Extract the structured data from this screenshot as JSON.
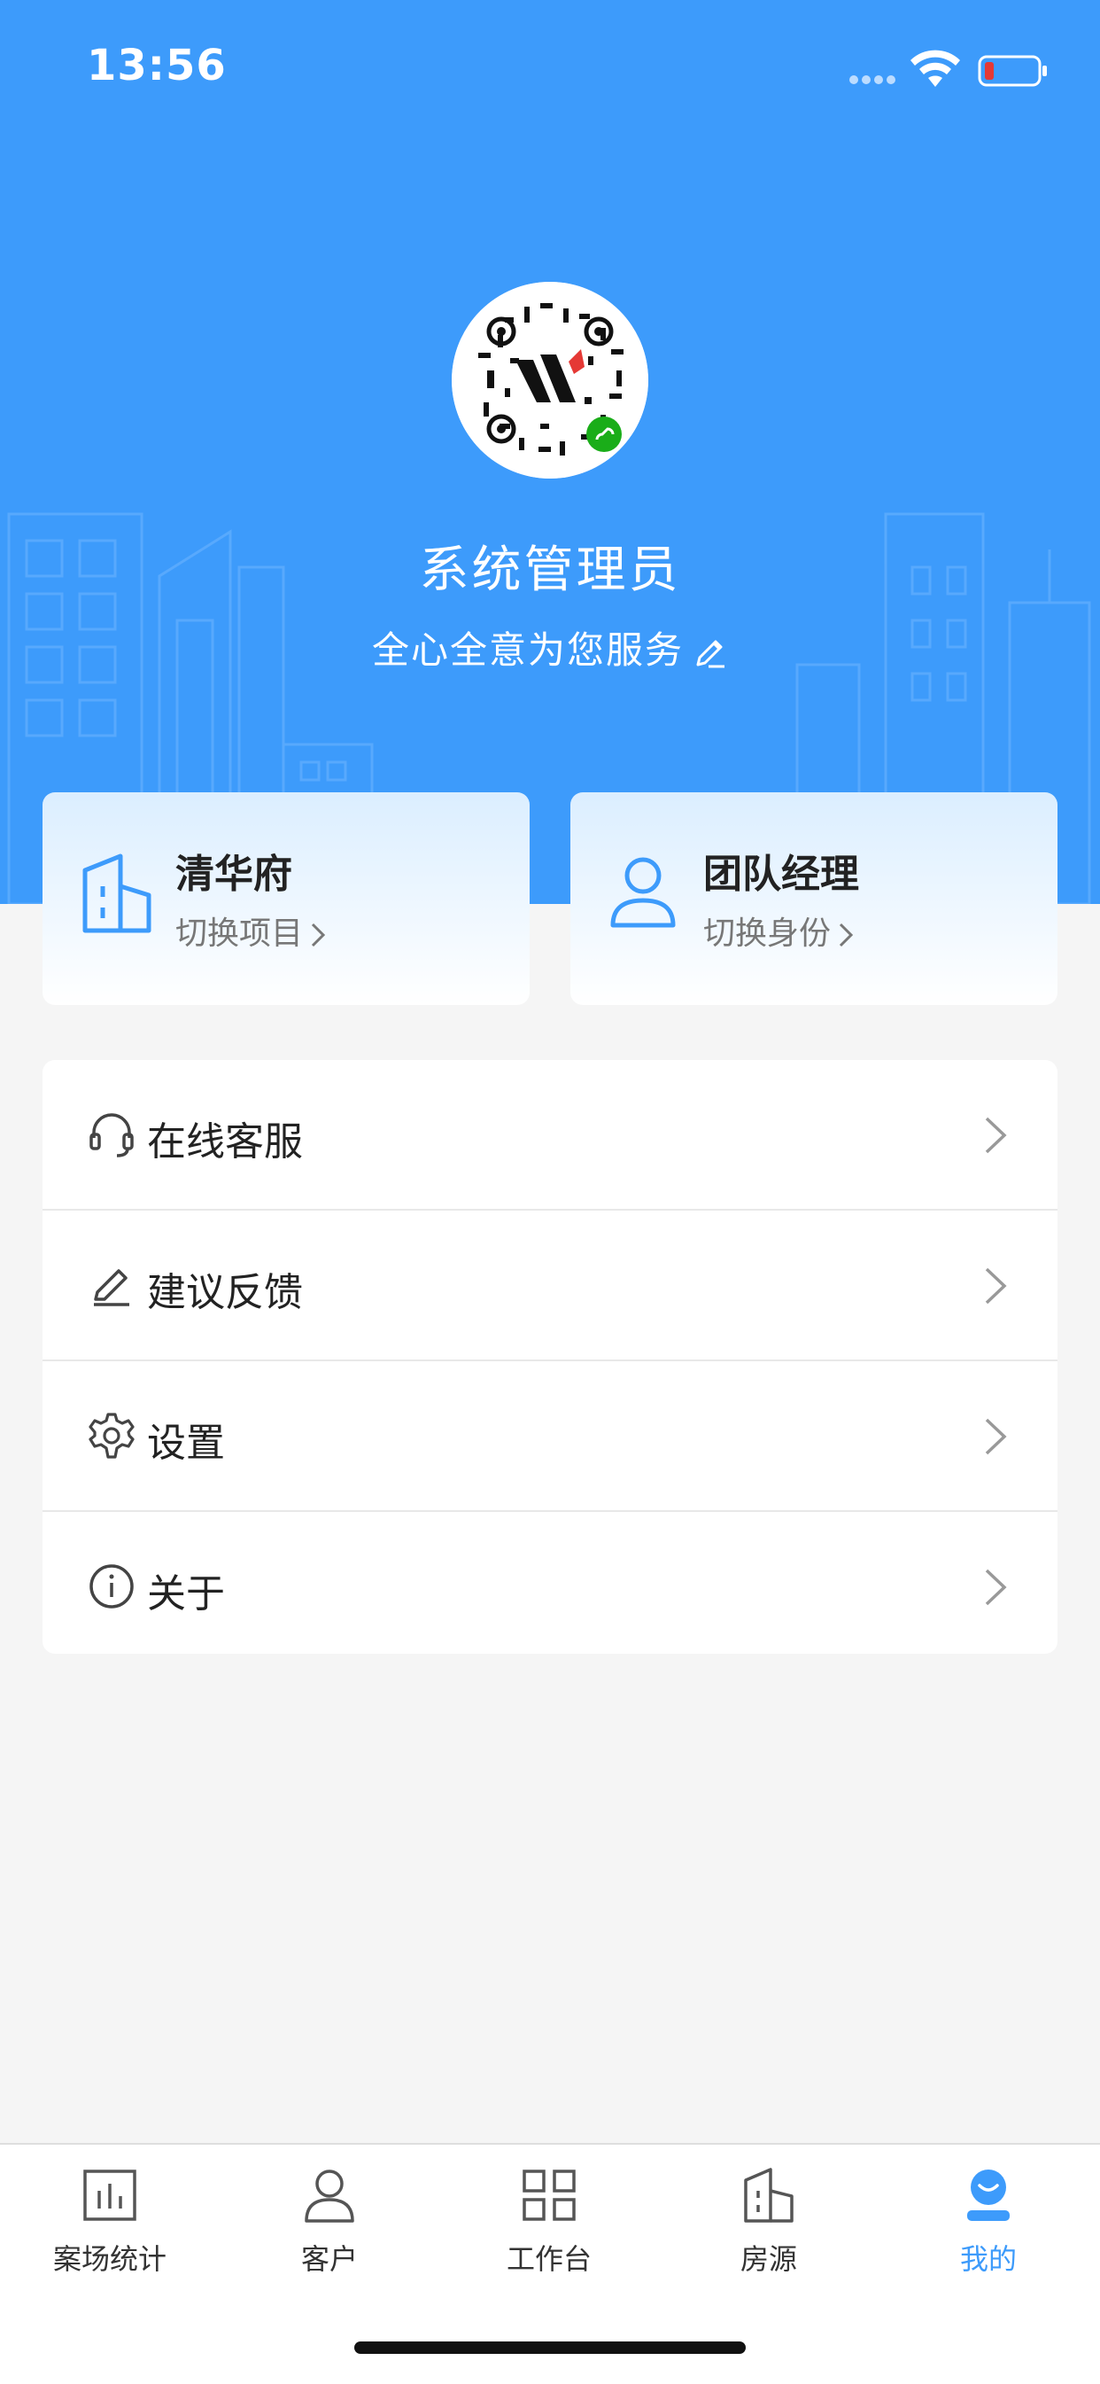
{
  "status_bar": {
    "time": "13:56"
  },
  "profile": {
    "name": "系统管理员",
    "motto": "全心全意为您服务"
  },
  "cards": {
    "project": {
      "title": "清华府",
      "action": "切换项目"
    },
    "identity": {
      "title": "团队经理",
      "action": "切换身份"
    }
  },
  "menu": {
    "items": [
      {
        "label": "在线客服",
        "icon": "headset-icon"
      },
      {
        "label": "建议反馈",
        "icon": "pencil-icon"
      },
      {
        "label": "设置",
        "icon": "gear-icon"
      },
      {
        "label": "关于",
        "icon": "info-icon"
      }
    ]
  },
  "tabbar": {
    "items": [
      {
        "label": "案场统计",
        "icon": "bar-chart-icon"
      },
      {
        "label": "客户",
        "icon": "person-icon"
      },
      {
        "label": "工作台",
        "icon": "grid-icon"
      },
      {
        "label": "房源",
        "icon": "building-icon"
      },
      {
        "label": "我的",
        "icon": "profile-face-icon"
      }
    ],
    "active_index": 4
  },
  "colors": {
    "primary": "#3d9bfb",
    "header_bg": "#3d9bfb",
    "page_bg": "#f5f5f5",
    "battery_low": "#e53935"
  }
}
